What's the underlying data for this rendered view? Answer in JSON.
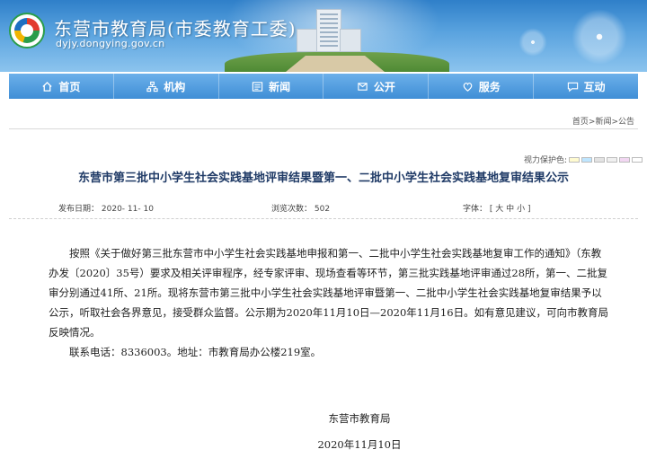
{
  "header": {
    "site_title": "东营市教育局(市委教育工委)",
    "site_url": "dyjy.dongying.gov.cn"
  },
  "nav": {
    "items": [
      {
        "label": "首页",
        "icon": "home-icon"
      },
      {
        "label": "机构",
        "icon": "org-icon"
      },
      {
        "label": "新闻",
        "icon": "news-icon"
      },
      {
        "label": "公开",
        "icon": "open-icon"
      },
      {
        "label": "服务",
        "icon": "service-icon"
      },
      {
        "label": "互动",
        "icon": "interact-icon"
      }
    ]
  },
  "breadcrumb": "首页>新闻>公告",
  "color_picker": {
    "label": "视力保护色:",
    "swatches": [
      "#fffbd0",
      "#bfe6ff",
      "#e3e3e3",
      "#f0f0f0",
      "#f2d7f2",
      "#ffffff"
    ]
  },
  "article": {
    "title": "东营市第三批中小学生社会实践基地评审结果暨第一、二批中小学生社会实践基地复审结果公示",
    "publish_label": "发布日期：",
    "publish_date": "2020- 11- 10",
    "views_label": "浏览次数：",
    "views": "502",
    "font_label": "字体：",
    "font_open": "[",
    "font_big": "大",
    "font_mid": "中",
    "font_small": "小",
    "font_close": "]",
    "paragraph1": "按照《关于做好第三批东营市中小学生社会实践基地申报和第一、二批中小学生社会实践基地复审工作的通知》（东教办发〔2020〕35号）要求及相关评审程序，经专家评审、现场查看等环节，第三批实践基地评审通过28所，第一、二批复审分别通过41所、21所。现将东营市第三批中小学生社会实践基地评审暨第一、二批中小学生社会实践基地复审结果予以公示，听取社会各界意见，接受群众监督。公示期为2020年11月10日—2020年11月16日。如有意见建议，可向市教育局反映情况。",
    "paragraph2": "联系电话：8336003。地址：市教育局办公楼219室。",
    "signature": "东营市教育局",
    "sign_date": "2020年11月10日"
  }
}
